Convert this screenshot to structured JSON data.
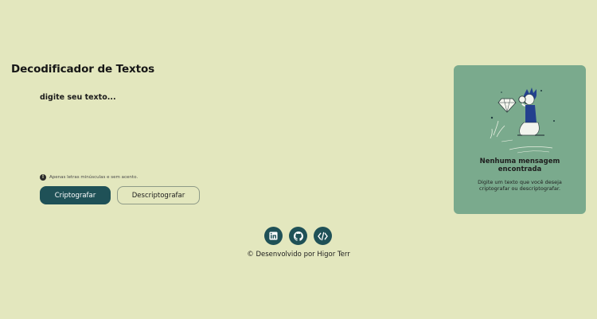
{
  "header": {
    "title": "Decodificador de Textos"
  },
  "input": {
    "placeholder": "digite seu texto..."
  },
  "hint": {
    "icon": "info-icon",
    "text": "Apenas letras minúsculas e sem acento."
  },
  "actions": {
    "encrypt_label": "Criptografar",
    "decrypt_label": "Descriptografar"
  },
  "result": {
    "illustration": "person-searching-illustration",
    "title_line1": "Nenhuma mensagem",
    "title_line2": "encontrada",
    "description": "Digite um texto que você deseja criptografar ou descriptografar."
  },
  "footer": {
    "links": [
      {
        "name": "LinkedIn",
        "icon": "linkedin-icon"
      },
      {
        "name": "GitHub",
        "icon": "github-icon"
      },
      {
        "name": "Portfolio",
        "icon": "code-icon"
      }
    ],
    "credit": "© Desenvolvido por Higor Terr"
  },
  "colors": {
    "background": "#e3e7be",
    "primary": "#1f5157",
    "panel": "#7aaa8d",
    "text": "#1b1b1b"
  }
}
